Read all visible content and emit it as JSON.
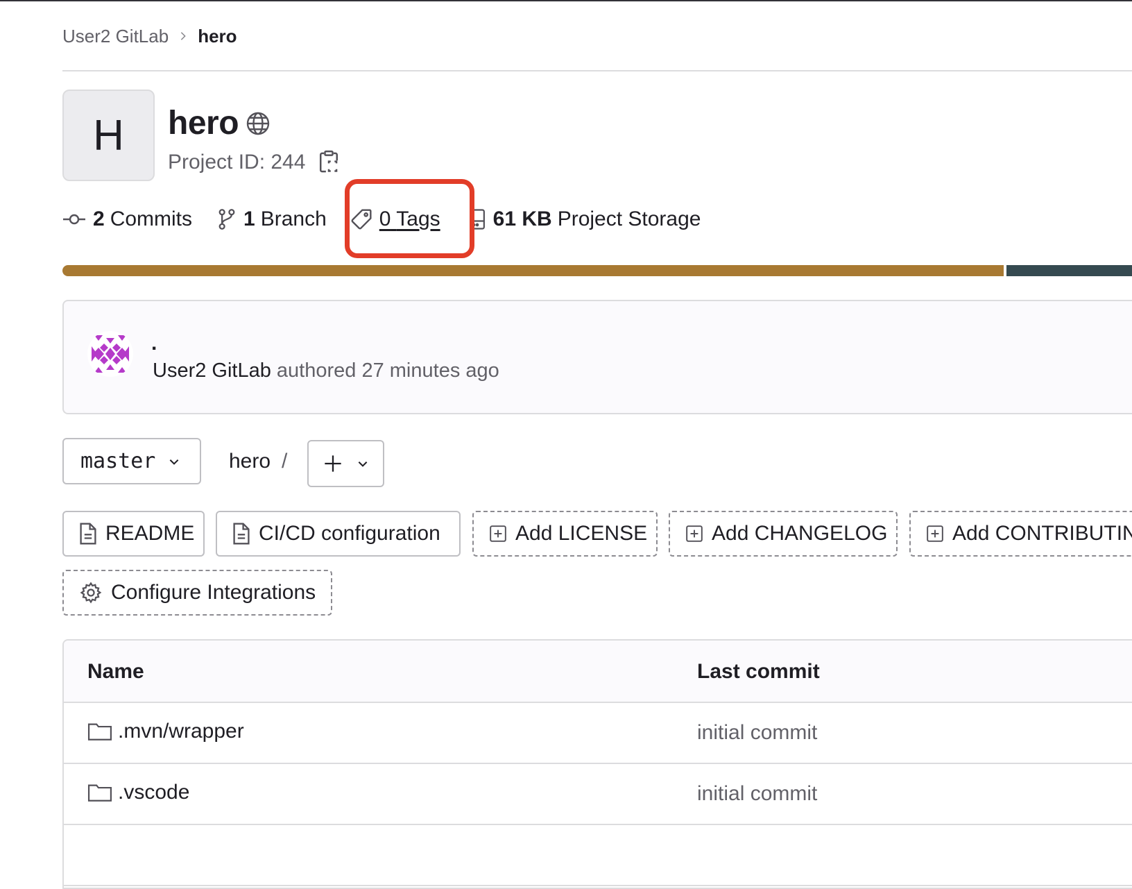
{
  "breadcrumb": {
    "parent": "User2 GitLab",
    "current": "hero"
  },
  "project": {
    "avatar_letter": "H",
    "name": "hero",
    "visibility_icon": "globe-icon",
    "id_label": "Project ID: 244"
  },
  "stats": {
    "commits": {
      "count": "2",
      "label": "Commits"
    },
    "branches": {
      "count": "1",
      "label": "Branch"
    },
    "tags": {
      "count": "0",
      "label": "Tags"
    },
    "storage": {
      "count": "61 KB",
      "label": "Project Storage"
    }
  },
  "language_bar": {
    "segments": [
      {
        "color": "#a87932",
        "fraction": 0.88
      },
      {
        "color": "#354a50",
        "fraction": 0.12
      }
    ]
  },
  "last_commit": {
    "title": ".",
    "author": "User2 GitLab",
    "authored_text": "authored 27 minutes ago"
  },
  "repo_nav": {
    "branch": "master",
    "path_root": "hero",
    "path_separator": "/"
  },
  "shortcuts": {
    "readme": "README",
    "cicd": "CI/CD configuration",
    "license": "Add LICENSE",
    "changelog": "Add CHANGELOG",
    "contributing": "Add CONTRIBUTING",
    "integrations": "Configure Integrations"
  },
  "file_table": {
    "headers": {
      "name": "Name",
      "last_commit": "Last commit"
    },
    "rows": [
      {
        "name": ".mvn/wrapper",
        "type": "folder",
        "last_commit": "initial commit"
      },
      {
        "name": ".vscode",
        "type": "folder",
        "last_commit": "initial commit"
      },
      {
        "name": "",
        "type": "folder",
        "last_commit": ""
      }
    ]
  },
  "colors": {
    "highlight_box": "#e23d28",
    "text_primary": "#1f1e24",
    "text_secondary": "#626168",
    "border": "#dcdcde",
    "identicon": "#b53ac9"
  }
}
